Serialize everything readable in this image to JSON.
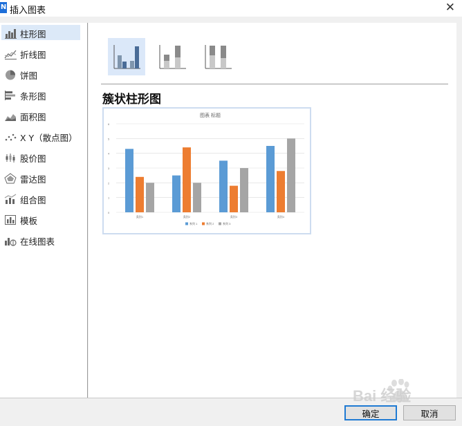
{
  "window": {
    "app_icon_letter": "N",
    "title": "插入图表",
    "close_glyph": "✕"
  },
  "sidebar": {
    "items": [
      {
        "label": "柱形图",
        "icon": "bar-chart-icon"
      },
      {
        "label": "折线图",
        "icon": "line-chart-icon"
      },
      {
        "label": "饼图",
        "icon": "pie-chart-icon"
      },
      {
        "label": "条形图",
        "icon": "horizontal-bar-icon"
      },
      {
        "label": "面积图",
        "icon": "area-chart-icon"
      },
      {
        "label": "X Y（散点图）",
        "icon": "scatter-chart-icon"
      },
      {
        "label": "股价图",
        "icon": "stock-chart-icon"
      },
      {
        "label": "雷达图",
        "icon": "radar-chart-icon"
      },
      {
        "label": "组合图",
        "icon": "combo-chart-icon"
      },
      {
        "label": "模板",
        "icon": "template-icon"
      },
      {
        "label": "在线图表",
        "icon": "online-chart-icon"
      }
    ],
    "selected_index": 0
  },
  "main": {
    "subtypes": [
      {
        "name": "clustered-column",
        "selected": true
      },
      {
        "name": "stacked-column",
        "selected": false
      },
      {
        "name": "percent-stacked-column",
        "selected": false
      }
    ],
    "chart_title": "簇状柱形图"
  },
  "chart_data": {
    "type": "bar",
    "title": "图表 标题",
    "categories": [
      "类别1",
      "类别2",
      "类别3",
      "类别4"
    ],
    "series": [
      {
        "name": "系列 1",
        "values": [
          4.3,
          2.5,
          3.5,
          4.5
        ],
        "color": "#5b9bd5"
      },
      {
        "name": "系列 2",
        "values": [
          2.4,
          4.4,
          1.8,
          2.8
        ],
        "color": "#ed7d31"
      },
      {
        "name": "系列 3",
        "values": [
          2,
          2,
          3,
          5
        ],
        "color": "#a5a5a5"
      }
    ],
    "ylim": [
      0,
      6
    ],
    "yticks": [
      "0",
      "1",
      "2",
      "3",
      "4",
      "5",
      "6"
    ],
    "grid": true,
    "legend": "bottom"
  },
  "footer": {
    "ok_label": "确定",
    "cancel_label": "取消"
  },
  "watermark": {
    "text": "Bai 经验"
  }
}
